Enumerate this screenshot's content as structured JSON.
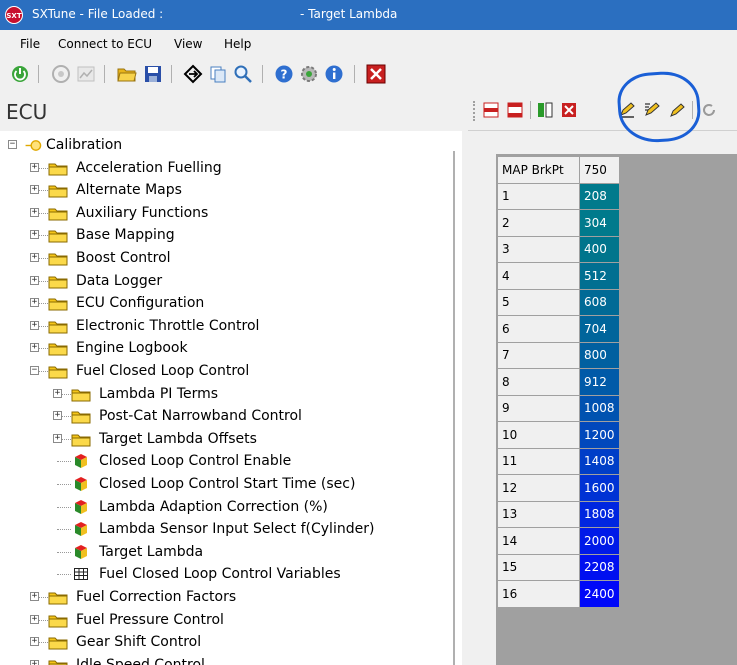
{
  "window": {
    "app_icon_text": "SXT",
    "title": "SXTune - File Loaded :",
    "title_right": "- Target Lambda"
  },
  "menu": [
    "File",
    "Connect to ECU",
    "View",
    "Help"
  ],
  "toolbar_icons": [
    "power-icon",
    "disconnect-icon",
    "chart-icon",
    "open-folder-icon",
    "save-icon",
    "navigate-icon",
    "copy-icon",
    "search-icon",
    "help-icon",
    "settings-icon",
    "info-icon",
    "close-icon"
  ],
  "ecu_pane": {
    "title": "ECU",
    "tree": [
      {
        "label": "Calibration",
        "type": "root",
        "expanded": true,
        "level": 0
      },
      {
        "label": "Acceleration Fuelling",
        "type": "folder",
        "expanded": false,
        "level": 1
      },
      {
        "label": "Alternate Maps",
        "type": "folder",
        "expanded": false,
        "level": 1
      },
      {
        "label": "Auxiliary Functions",
        "type": "folder",
        "expanded": false,
        "level": 1
      },
      {
        "label": "Base Mapping",
        "type": "folder",
        "expanded": false,
        "level": 1
      },
      {
        "label": "Boost Control",
        "type": "folder",
        "expanded": false,
        "level": 1
      },
      {
        "label": "Data Logger",
        "type": "folder",
        "expanded": false,
        "level": 1
      },
      {
        "label": "ECU Configuration",
        "type": "folder",
        "expanded": false,
        "level": 1
      },
      {
        "label": "Electronic Throttle Control",
        "type": "folder",
        "expanded": false,
        "level": 1
      },
      {
        "label": "Engine Logbook",
        "type": "folder",
        "expanded": false,
        "level": 1
      },
      {
        "label": "Fuel Closed Loop Control",
        "type": "folder",
        "expanded": true,
        "level": 1
      },
      {
        "label": "Lambda PI Terms",
        "type": "folder",
        "expanded": false,
        "level": 2
      },
      {
        "label": "Post-Cat Narrowband Control",
        "type": "folder",
        "expanded": false,
        "level": 2
      },
      {
        "label": "Target Lambda Offsets",
        "type": "folder",
        "expanded": false,
        "level": 2
      },
      {
        "label": "Closed Loop Control Enable",
        "type": "cube",
        "level": 2
      },
      {
        "label": "Closed Loop Control Start Time (sec)",
        "type": "cube",
        "level": 2
      },
      {
        "label": "Lambda Adaption Correction (%)",
        "type": "cube",
        "level": 2
      },
      {
        "label": "Lambda Sensor Input Select f(Cylinder)",
        "type": "cube",
        "level": 2
      },
      {
        "label": "Target Lambda",
        "type": "cube",
        "level": 2,
        "selected": true
      },
      {
        "label": "Fuel Closed Loop Control Variables",
        "type": "table",
        "level": 2
      },
      {
        "label": "Fuel Correction Factors",
        "type": "folder",
        "expanded": false,
        "level": 1
      },
      {
        "label": "Fuel Pressure Control",
        "type": "folder",
        "expanded": false,
        "level": 1
      },
      {
        "label": "Gear Shift Control",
        "type": "folder",
        "expanded": false,
        "level": 1
      },
      {
        "label": "Idle Speed Control",
        "type": "folder",
        "expanded": false,
        "level": 1
      }
    ]
  },
  "map_table": {
    "corner_label": "MAP BrkPt",
    "column_header": "750",
    "rows": [
      {
        "index": "1",
        "value": "208",
        "color": "#007a8c"
      },
      {
        "index": "2",
        "value": "304",
        "color": "#007a8c"
      },
      {
        "index": "3",
        "value": "400",
        "color": "#00758c"
      },
      {
        "index": "4",
        "value": "512",
        "color": "#006f91"
      },
      {
        "index": "5",
        "value": "608",
        "color": "#006a96"
      },
      {
        "index": "6",
        "value": "704",
        "color": "#00659b"
      },
      {
        "index": "7",
        "value": "800",
        "color": "#0060a0"
      },
      {
        "index": "8",
        "value": "912",
        "color": "#005aa8"
      },
      {
        "index": "9",
        "value": "1008",
        "color": "#0052b0"
      },
      {
        "index": "10",
        "value": "1200",
        "color": "#0048bc"
      },
      {
        "index": "11",
        "value": "1408",
        "color": "#003ec8"
      },
      {
        "index": "12",
        "value": "1600",
        "color": "#0032d4"
      },
      {
        "index": "13",
        "value": "1808",
        "color": "#0026e0"
      },
      {
        "index": "14",
        "value": "2000",
        "color": "#001ae8"
      },
      {
        "index": "15",
        "value": "2208",
        "color": "#0010f0"
      },
      {
        "index": "16",
        "value": "2400",
        "color": "#0008f8"
      }
    ]
  },
  "map_toolbar_icons": [
    "insert-row-icon",
    "delete-row-icon",
    "insert-column-icon",
    "delete-column-icon",
    "edit-cell-icon",
    "edit-all-icon",
    "pencil-icon",
    "refresh-icon"
  ],
  "colors": {
    "titlebar": "#2b6fc0",
    "annotation": "#1a5fd6",
    "folder": "#f5c518"
  }
}
